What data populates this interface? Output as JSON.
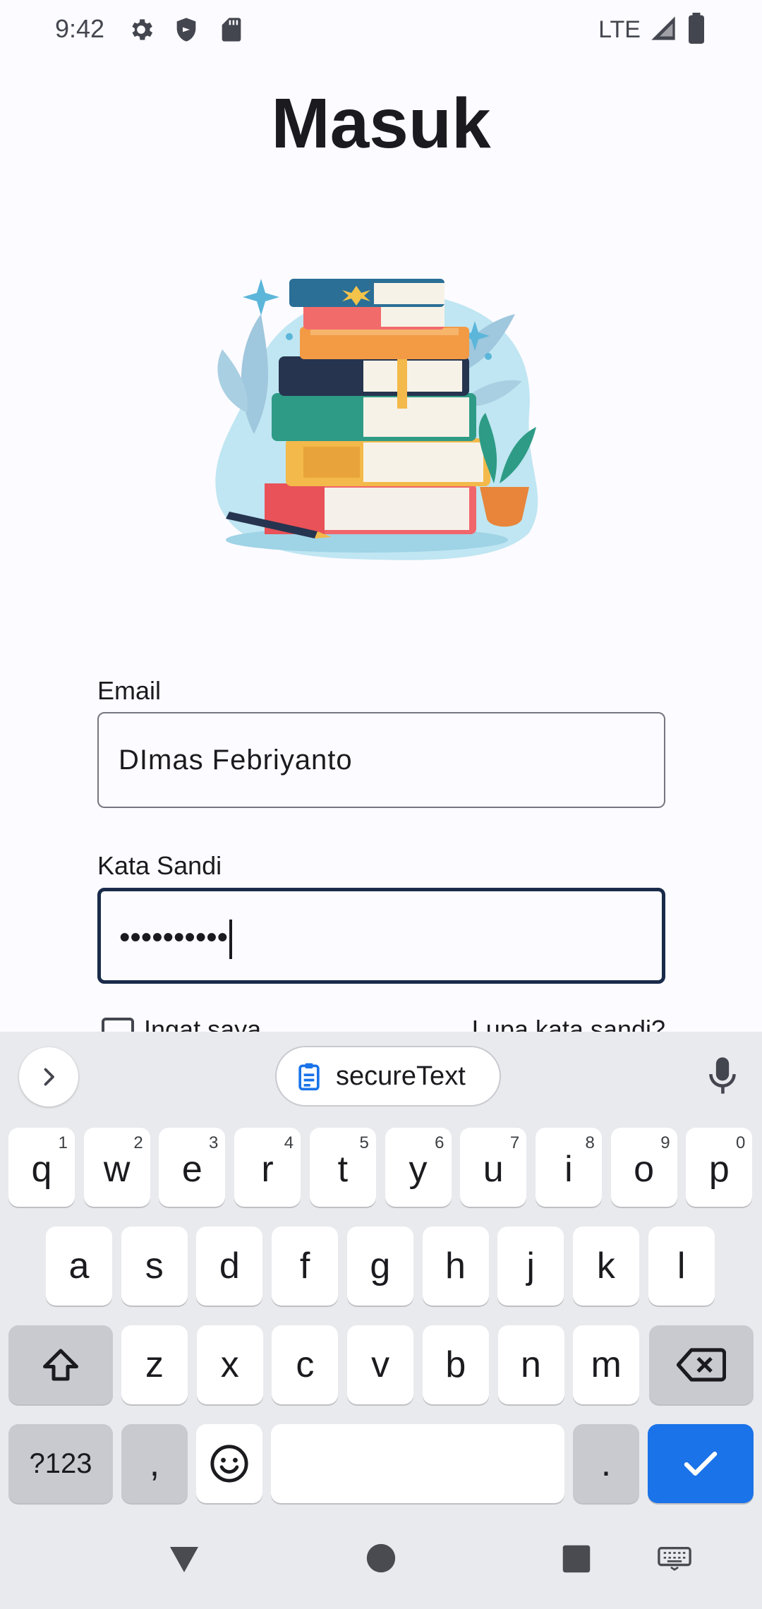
{
  "status_bar": {
    "time": "9:42",
    "network": "LTE",
    "left_icons": [
      "gear-icon",
      "shield-icon",
      "sd-card-icon"
    ],
    "right_icons": [
      "signal-icon",
      "battery-icon"
    ]
  },
  "page": {
    "title": "Masuk"
  },
  "form": {
    "email_label": "Email",
    "email_value": "DImas Febriyanto",
    "password_label": "Kata Sandi",
    "password_value": "••••••••••",
    "remember_label": "Ingat saya",
    "forgot_label": "Lupa kata sandi?"
  },
  "keyboard": {
    "suggestion_chip": "secureText",
    "row1": [
      {
        "key": "q",
        "hint": "1"
      },
      {
        "key": "w",
        "hint": "2"
      },
      {
        "key": "e",
        "hint": "3"
      },
      {
        "key": "r",
        "hint": "4"
      },
      {
        "key": "t",
        "hint": "5"
      },
      {
        "key": "y",
        "hint": "6"
      },
      {
        "key": "u",
        "hint": "7"
      },
      {
        "key": "i",
        "hint": "8"
      },
      {
        "key": "o",
        "hint": "9"
      },
      {
        "key": "p",
        "hint": "0"
      }
    ],
    "row2": [
      "a",
      "s",
      "d",
      "f",
      "g",
      "h",
      "j",
      "k",
      "l"
    ],
    "row3": [
      "z",
      "x",
      "c",
      "v",
      "b",
      "n",
      "m"
    ],
    "symbols_label": "?123",
    "comma_label": ",",
    "period_label": ".",
    "accent_color": "#1a73e8"
  },
  "nav_bar": {
    "icons": [
      "back-icon",
      "home-icon",
      "recents-icon",
      "keyboard-switch-icon"
    ]
  }
}
